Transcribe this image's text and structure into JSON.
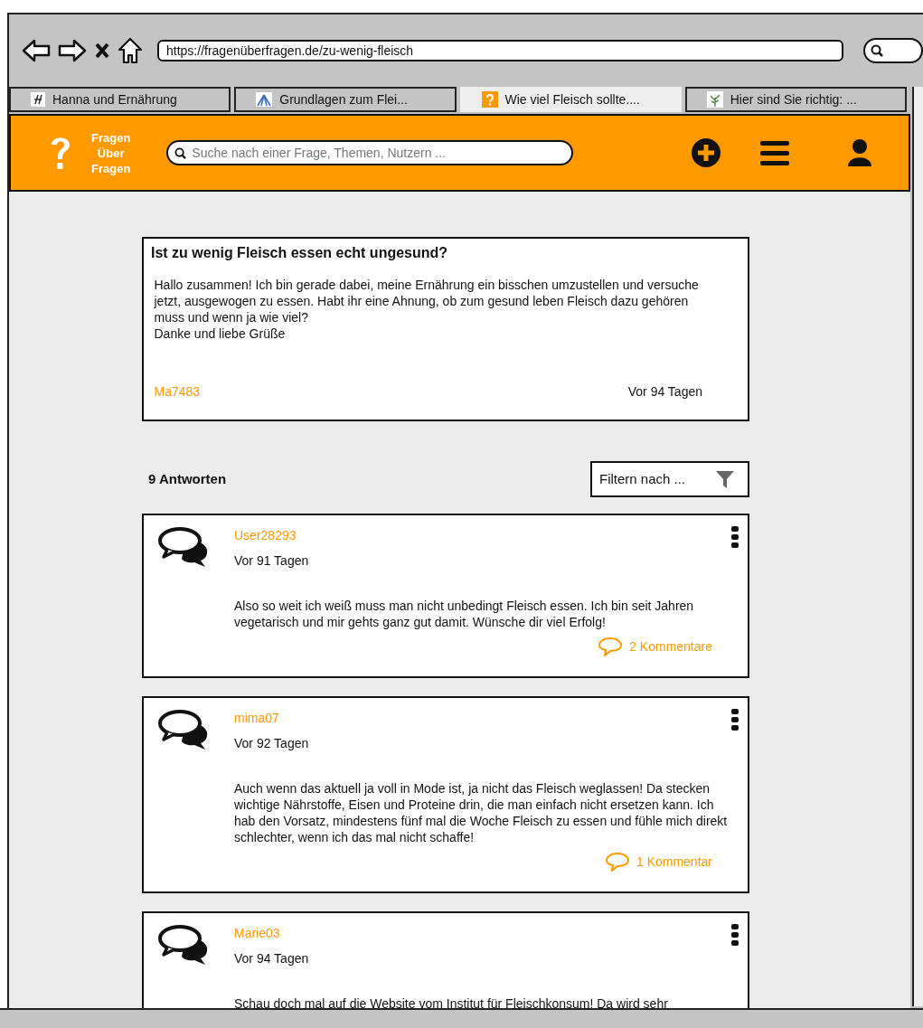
{
  "browser": {
    "url": "https://fragenüberfragen.de/zu-wenig-fleisch",
    "tabs": [
      {
        "title": "Hanna und Ernährung",
        "selected": false,
        "kind": "letter"
      },
      {
        "title": "Grundlagen zum Flei...",
        "selected": false,
        "kind": "emblem"
      },
      {
        "title": "Wie viel Fleisch sollte....",
        "selected": true,
        "kind": "question"
      },
      {
        "title": "Hier sind Sie richtig: ...",
        "selected": false,
        "kind": "plant"
      }
    ]
  },
  "header": {
    "logo_lines": [
      "Fragen",
      "Über",
      "Fragen"
    ],
    "search": {
      "placeholder": "Suche nach einer Frage, Themen, Nutzern ..."
    }
  },
  "question": {
    "title": "Ist zu wenig Fleisch essen echt ungesund?",
    "body": [
      "Hallo zusammen! Ich bin gerade dabei, meine Ernährung ein bisschen umzustellen und versuche jetzt,  ausgewogen zu essen. Habt ihr eine Ahnung, ob zum gesund leben Fleisch dazu gehören muss und wenn ja wie viel?",
      "Danke und liebe Grüße"
    ],
    "author": "Ma7483",
    "time": "Vor 94 Tagen"
  },
  "answers_count": "9 Antworten",
  "filter": {
    "label": "Filtern nach ..."
  },
  "answers": [
    {
      "user": "User28293",
      "time": "Vor 91 Tagen",
      "text": "Also so weit ich weiß muss man nicht unbedingt Fleisch essen. Ich bin seit Jahren vegetarisch und mir gehts ganz gut damit. Wünsche dir viel Erfolg!",
      "comments": "2 Kommentare"
    },
    {
      "user": "mima07",
      "time": "Vor 92 Tagen",
      "text": "Auch wenn das aktuell ja voll in Mode ist, ja nicht das Fleisch weglassen! Da stecken wichtige Nährstoffe, Eisen und Proteine drin, die man einfach nicht ersetzen kann. Ich hab den Vorsatz, mindestens fünf mal die Woche Fleisch zu essen und fühle mich direkt schlechter, wenn ich das mal nicht schaffe!",
      "comments": "1 Kommentar"
    },
    {
      "user": "Marie03",
      "time": "Vor 94 Tagen",
      "text": "Schau doch mal auf die Website vom Institut für Fleischkonsum! Da wird sehr"
    }
  ]
}
